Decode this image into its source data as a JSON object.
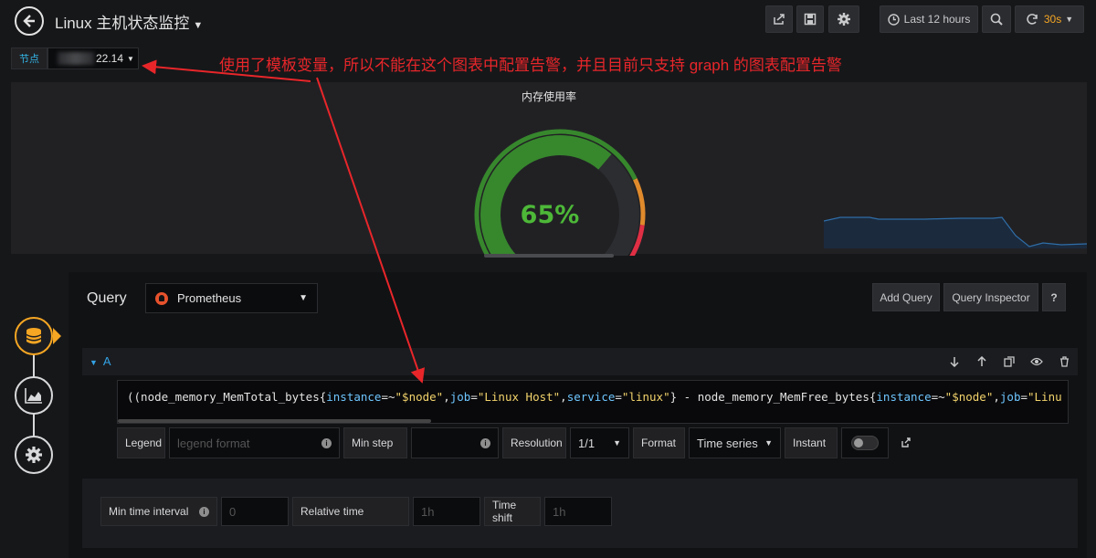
{
  "topbar": {
    "title": "Linux 主机状态监控",
    "time_range": "Last 12 hours",
    "refresh_interval": "30s",
    "icons": [
      "back-arrow-icon",
      "share-icon",
      "save-icon",
      "gear-icon",
      "clock-icon",
      "zoom-out-icon",
      "refresh-icon"
    ]
  },
  "variable": {
    "label": "节点",
    "value": "22.14"
  },
  "annotation": "使用了模板变量，所以不能在这个图表中配置告警，并且目前只支持 graph 的图表配置告警",
  "panel": {
    "title": "内存使用率",
    "gauge_value": "65%",
    "gauge_fraction": 0.65,
    "colors": {
      "green": "#37872d",
      "orange": "#e08a2c",
      "red": "#e02f44",
      "value": "#4db838"
    }
  },
  "editor": {
    "query_label": "Query",
    "datasource": "Prometheus",
    "add_query": "Add Query",
    "query_inspector": "Query Inspector",
    "help": "?",
    "ref_id": "A",
    "expr_parts": [
      {
        "c": "p",
        "t": "((node_memory_MemTotal_bytes{"
      },
      {
        "c": "k",
        "t": "instance"
      },
      {
        "c": "p",
        "t": "=~"
      },
      {
        "c": "s",
        "t": "\"$node\""
      },
      {
        "c": "p",
        "t": ","
      },
      {
        "c": "k",
        "t": "job"
      },
      {
        "c": "p",
        "t": "="
      },
      {
        "c": "s",
        "t": "\"Linux Host\""
      },
      {
        "c": "p",
        "t": ","
      },
      {
        "c": "k",
        "t": "service"
      },
      {
        "c": "p",
        "t": "="
      },
      {
        "c": "s",
        "t": "\"linux\""
      },
      {
        "c": "p",
        "t": "} - node_memory_MemFree_bytes{"
      },
      {
        "c": "k",
        "t": "instance"
      },
      {
        "c": "p",
        "t": "=~"
      },
      {
        "c": "s",
        "t": "\"$node\""
      },
      {
        "c": "p",
        "t": ","
      },
      {
        "c": "k",
        "t": "job"
      },
      {
        "c": "p",
        "t": "="
      },
      {
        "c": "s",
        "t": "\"Linu"
      }
    ],
    "options": {
      "legend_label": "Legend",
      "legend_placeholder": "legend format",
      "min_step_label": "Min step",
      "resolution_label": "Resolution",
      "resolution_value": "1/1",
      "format_label": "Format",
      "format_value": "Time series",
      "instant_label": "Instant"
    },
    "time": {
      "min_interval_label": "Min time interval",
      "min_interval_placeholder": "0",
      "relative_time_label": "Relative time",
      "relative_time_placeholder": "1h",
      "time_shift_label": "Time shift",
      "time_shift_placeholder": "1h"
    }
  },
  "rail": {
    "items": [
      "queries-database-icon",
      "visualization-chart-icon",
      "general-settings-gear-icon"
    ]
  }
}
